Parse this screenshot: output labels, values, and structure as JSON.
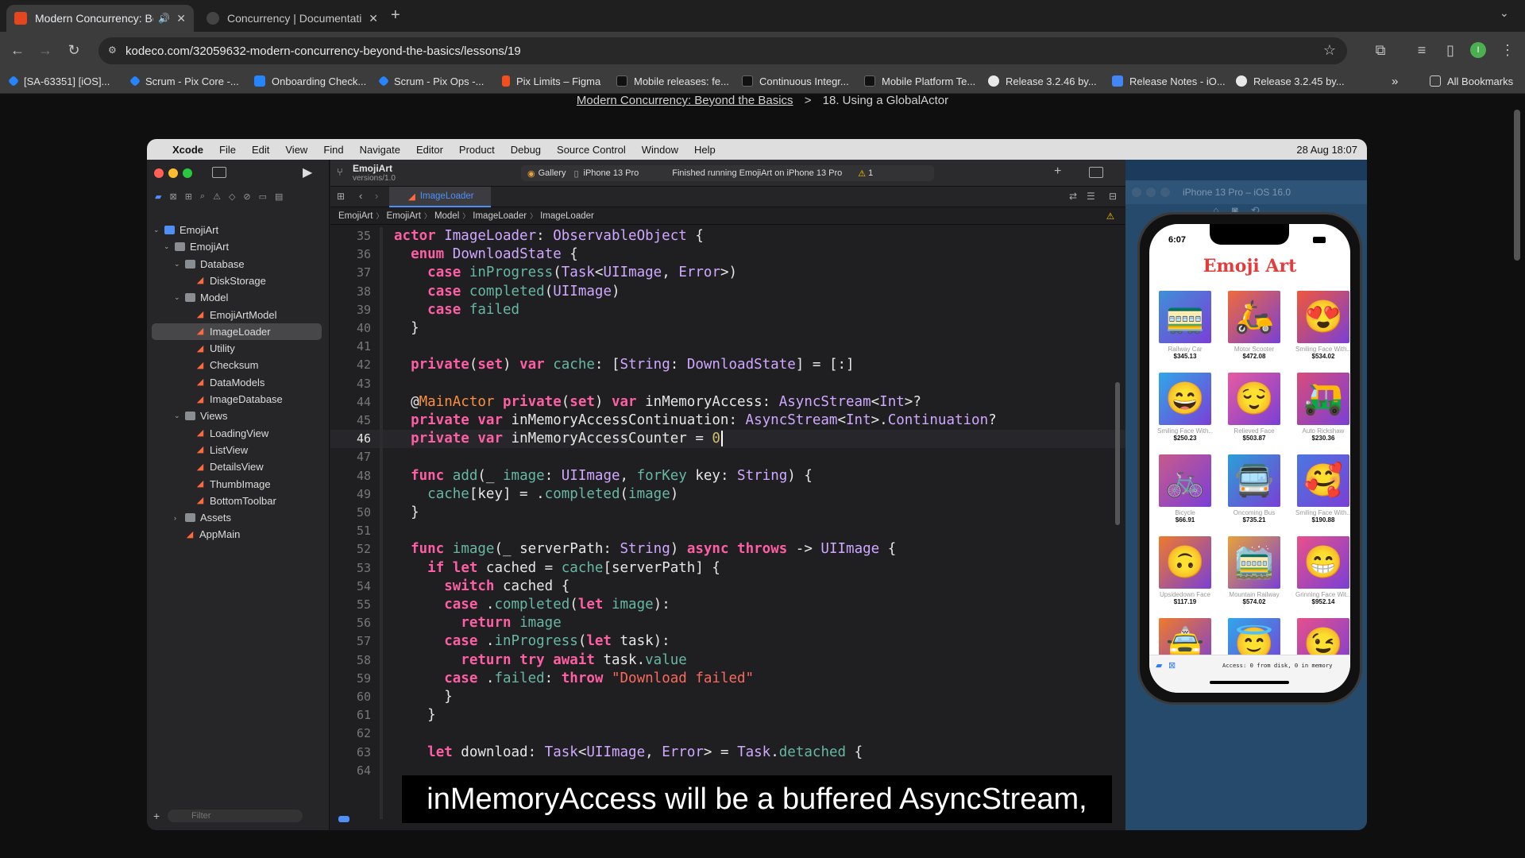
{
  "browser": {
    "tabs": [
      {
        "title": "Modern Concurrency: Bey",
        "active": true
      },
      {
        "title": "Concurrency | Documentation",
        "active": false
      }
    ],
    "new_tab": "+",
    "url": "kodeco.com/32059632-modern-concurrency-beyond-the-basics/lessons/19",
    "bookmarks": [
      "[SA-63351] [iOS]...",
      "Scrum - Pix Core -...",
      "Onboarding Check...",
      "Scrum - Pix Ops -...",
      "Pix Limits – Figma",
      "Mobile releases: fe...",
      "Continuous Integr...",
      "Mobile Platform Te...",
      "Release 3.2.46 by...",
      "Release Notes - iO...",
      "Release 3.2.45 by..."
    ],
    "all_bookmarks": "All Bookmarks",
    "profile_initial": "I"
  },
  "page": {
    "breadcrumb_link": "Modern Concurrency: Beyond the Basics",
    "breadcrumb_sep": ">",
    "breadcrumb_current": "18. Using a GlobalActor",
    "caption": "inMemoryAccess will be a buffered AsyncStream,"
  },
  "mac": {
    "menus": [
      "Xcode",
      "File",
      "Edit",
      "View",
      "Find",
      "Navigate",
      "Editor",
      "Product",
      "Debug",
      "Source Control",
      "Window",
      "Help"
    ],
    "datetime": "28 Aug  18:07"
  },
  "xcode": {
    "project": "EmojiArt",
    "version": "versions/1.0",
    "scheme": "Gallery",
    "device": "iPhone 13 Pro",
    "status": "Finished running EmojiArt on iPhone 13 Pro",
    "warnings": "1",
    "tab": "ImageLoader",
    "jumpbar": [
      "EmojiArt",
      "EmojiArt",
      "Model",
      "ImageLoader",
      "ImageLoader"
    ],
    "filter_placeholder": "Filter",
    "tree": [
      {
        "label": "EmojiArt",
        "level": 0,
        "kind": "project"
      },
      {
        "label": "EmojiArt",
        "level": 1,
        "kind": "folder"
      },
      {
        "label": "Database",
        "level": 2,
        "kind": "folder"
      },
      {
        "label": "DiskStorage",
        "level": 3,
        "kind": "swift"
      },
      {
        "label": "Model",
        "level": 2,
        "kind": "folder"
      },
      {
        "label": "EmojiArtModel",
        "level": 3,
        "kind": "swift"
      },
      {
        "label": "ImageLoader",
        "level": 3,
        "kind": "swift",
        "selected": true
      },
      {
        "label": "Utility",
        "level": 3,
        "kind": "swift"
      },
      {
        "label": "Checksum",
        "level": 3,
        "kind": "swift"
      },
      {
        "label": "DataModels",
        "level": 3,
        "kind": "swift"
      },
      {
        "label": "ImageDatabase",
        "level": 3,
        "kind": "swift"
      },
      {
        "label": "Views",
        "level": 2,
        "kind": "folder"
      },
      {
        "label": "LoadingView",
        "level": 3,
        "kind": "swift"
      },
      {
        "label": "ListView",
        "level": 3,
        "kind": "swift"
      },
      {
        "label": "DetailsView",
        "level": 3,
        "kind": "swift"
      },
      {
        "label": "ThumbImage",
        "level": 3,
        "kind": "swift"
      },
      {
        "label": "BottomToolbar",
        "level": 3,
        "kind": "swift"
      },
      {
        "label": "Assets",
        "level": 2,
        "kind": "folder"
      },
      {
        "label": "AppMain",
        "level": 2,
        "kind": "swift"
      }
    ],
    "code_lines": [
      {
        "n": "35",
        "t": "actor ImageLoader: ObservableObject {"
      },
      {
        "n": "36",
        "t": "  enum DownloadState {"
      },
      {
        "n": "37",
        "t": "    case inProgress(Task<UIImage, Error>)"
      },
      {
        "n": "38",
        "t": "    case completed(UIImage)"
      },
      {
        "n": "39",
        "t": "    case failed"
      },
      {
        "n": "40",
        "t": "  }"
      },
      {
        "n": "41",
        "t": ""
      },
      {
        "n": "42",
        "t": "  private(set) var cache: [String: DownloadState] = [:]"
      },
      {
        "n": "43",
        "t": ""
      },
      {
        "n": "44",
        "t": "  @MainActor private(set) var inMemoryAccess: AsyncStream<Int>?"
      },
      {
        "n": "45",
        "t": "  private var inMemoryAccessContinuation: AsyncStream<Int>.Continuation?"
      },
      {
        "n": "46",
        "t": "  private var inMemoryAccessCounter = 0",
        "current": true
      },
      {
        "n": "47",
        "t": ""
      },
      {
        "n": "48",
        "t": "  func add(_ image: UIImage, forKey key: String) {"
      },
      {
        "n": "49",
        "t": "    cache[key] = .completed(image)"
      },
      {
        "n": "50",
        "t": "  }"
      },
      {
        "n": "51",
        "t": ""
      },
      {
        "n": "52",
        "t": "  func image(_ serverPath: String) async throws -> UIImage {"
      },
      {
        "n": "53",
        "t": "    if let cached = cache[serverPath] {"
      },
      {
        "n": "54",
        "t": "      switch cached {"
      },
      {
        "n": "55",
        "t": "      case .completed(let image):"
      },
      {
        "n": "56",
        "t": "        return image"
      },
      {
        "n": "57",
        "t": "      case .inProgress(let task):"
      },
      {
        "n": "58",
        "t": "        return try await task.value"
      },
      {
        "n": "59",
        "t": "      case .failed: throw \"Download failed\""
      },
      {
        "n": "60",
        "t": "      }"
      },
      {
        "n": "61",
        "t": "    }"
      },
      {
        "n": "62",
        "t": ""
      },
      {
        "n": "63",
        "t": "    let download: Task<UIImage, Error> = Task.detached {"
      },
      {
        "n": "64",
        "t": ""
      }
    ]
  },
  "simulator": {
    "title": "iPhone 13 Pro – iOS 16.0",
    "time": "6:07",
    "app_title": "Emoji Art",
    "footer": "Access: 0 from disk, 0 in memory",
    "items": [
      {
        "name": "Railway Car",
        "price": "$345.13",
        "emoji": "🚃",
        "color": "#3f8fd8"
      },
      {
        "name": "Motor Scooter",
        "price": "$472.08",
        "emoji": "🛵",
        "color": "#f06a3a"
      },
      {
        "name": "Smiling Face With...",
        "price": "$534.02",
        "emoji": "😍",
        "color": "#f0573a"
      },
      {
        "name": "Smiling Face With...",
        "price": "$250.23",
        "emoji": "😄",
        "color": "#2fa7e8"
      },
      {
        "name": "Relieved Face",
        "price": "$503.87",
        "emoji": "😌",
        "color": "#e65b9f"
      },
      {
        "name": "Auto Rickshaw",
        "price": "$230.36",
        "emoji": "🛺",
        "color": "#d94c7a"
      },
      {
        "name": "Bicycle",
        "price": "$66.91",
        "emoji": "🚲",
        "color": "#c85a8c"
      },
      {
        "name": "Oncoming Bus",
        "price": "$735.21",
        "emoji": "🚍",
        "color": "#2b9fd6"
      },
      {
        "name": "Smiling Face With...",
        "price": "$190.88",
        "emoji": "🥰",
        "color": "#4a78e0"
      },
      {
        "name": "Upsidedown Face",
        "price": "$117.19",
        "emoji": "🙃",
        "color": "#f07a2a"
      },
      {
        "name": "Mountain Railway",
        "price": "$574.02",
        "emoji": "🚞",
        "color": "#e8a23a"
      },
      {
        "name": "Grinning Face Wit...",
        "price": "$952.14",
        "emoji": "😁",
        "color": "#e8508a"
      },
      {
        "name": "",
        "price": "",
        "emoji": "🚖",
        "color": "#f07a2a"
      },
      {
        "name": "",
        "price": "",
        "emoji": "😇",
        "color": "#2fa7e8"
      },
      {
        "name": "",
        "price": "",
        "emoji": "😉",
        "color": "#e6508a"
      }
    ]
  },
  "colors": {
    "accent": "#4f8ff7",
    "swift": "#ff6a3d",
    "keyword": "#fc5fa3",
    "type": "#d0a8ff"
  }
}
